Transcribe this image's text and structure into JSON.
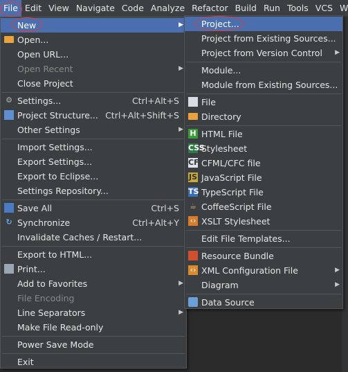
{
  "menubar": {
    "items": [
      {
        "label": "File",
        "name": "menubar-file",
        "active": true
      },
      {
        "label": "Edit",
        "name": "menubar-edit"
      },
      {
        "label": "View",
        "name": "menubar-view"
      },
      {
        "label": "Navigate",
        "name": "menubar-navigate"
      },
      {
        "label": "Code",
        "name": "menubar-code"
      },
      {
        "label": "Analyze",
        "name": "menubar-analyze"
      },
      {
        "label": "Refactor",
        "name": "menubar-refactor"
      },
      {
        "label": "Build",
        "name": "menubar-build"
      },
      {
        "label": "Run",
        "name": "menubar-run"
      },
      {
        "label": "Tools",
        "name": "menubar-tools"
      },
      {
        "label": "VCS",
        "name": "menubar-vcs"
      },
      {
        "label": "W",
        "name": "menubar-window"
      }
    ]
  },
  "file_menu": {
    "items": [
      {
        "type": "item",
        "label": "New",
        "name": "file-new",
        "selected": true,
        "arrow": true
      },
      {
        "type": "item",
        "label": "Open...",
        "name": "file-open",
        "icon": "folder",
        "icon_name": "folder-icon"
      },
      {
        "type": "item",
        "label": "Open URL...",
        "name": "file-open-url"
      },
      {
        "type": "item",
        "label": "Open Recent",
        "name": "file-open-recent",
        "disabled": true,
        "arrow": true
      },
      {
        "type": "item",
        "label": "Close Project",
        "name": "file-close-project"
      },
      {
        "type": "sep"
      },
      {
        "type": "item",
        "label": "Settings...",
        "name": "file-settings",
        "icon": "gear",
        "icon_name": "settings-icon",
        "shortcut": "Ctrl+Alt+S"
      },
      {
        "type": "item",
        "label": "Project Structure...",
        "name": "file-project-structure",
        "icon": "grid",
        "icon_name": "project-structure-icon",
        "shortcut": "Ctrl+Alt+Shift+S"
      },
      {
        "type": "item",
        "label": "Other Settings",
        "name": "file-other-settings",
        "arrow": true
      },
      {
        "type": "sep"
      },
      {
        "type": "item",
        "label": "Import Settings...",
        "name": "file-import-settings"
      },
      {
        "type": "item",
        "label": "Export Settings...",
        "name": "file-export-settings"
      },
      {
        "type": "item",
        "label": "Export to Eclipse...",
        "name": "file-export-eclipse"
      },
      {
        "type": "item",
        "label": "Settings Repository...",
        "name": "file-settings-repository"
      },
      {
        "type": "sep"
      },
      {
        "type": "item",
        "label": "Save All",
        "name": "file-save-all",
        "icon": "disk",
        "icon_name": "save-icon",
        "shortcut": "Ctrl+S"
      },
      {
        "type": "item",
        "label": "Synchronize",
        "name": "file-synchronize",
        "icon": "sync",
        "icon_name": "sync-icon",
        "shortcut": "Ctrl+Alt+Y"
      },
      {
        "type": "item",
        "label": "Invalidate Caches / Restart...",
        "name": "file-invalidate-caches"
      },
      {
        "type": "sep"
      },
      {
        "type": "item",
        "label": "Export to HTML...",
        "name": "file-export-html"
      },
      {
        "type": "item",
        "label": "Print...",
        "name": "file-print",
        "icon": "printer",
        "icon_name": "printer-icon"
      },
      {
        "type": "item",
        "label": "Add to Favorites",
        "name": "file-add-favorites",
        "arrow": true
      },
      {
        "type": "item",
        "label": "File Encoding",
        "name": "file-encoding",
        "disabled": true
      },
      {
        "type": "item",
        "label": "Line Separators",
        "name": "file-line-separators",
        "arrow": true
      },
      {
        "type": "item",
        "label": "Make File Read-only",
        "name": "file-make-read-only"
      },
      {
        "type": "sep"
      },
      {
        "type": "item",
        "label": "Power Save Mode",
        "name": "file-power-save"
      },
      {
        "type": "sep"
      },
      {
        "type": "item",
        "label": "Exit",
        "name": "file-exit"
      }
    ]
  },
  "new_menu": {
    "items": [
      {
        "type": "item",
        "label": "Project...",
        "name": "new-project",
        "selected": true
      },
      {
        "type": "item",
        "label": "Project from Existing Sources...",
        "name": "new-project-existing"
      },
      {
        "type": "item",
        "label": "Project from Version Control",
        "name": "new-project-vcs",
        "arrow": true
      },
      {
        "type": "sep"
      },
      {
        "type": "item",
        "label": "Module...",
        "name": "new-module"
      },
      {
        "type": "item",
        "label": "Module from Existing Sources...",
        "name": "new-module-existing"
      },
      {
        "type": "sep"
      },
      {
        "type": "item",
        "label": "File",
        "name": "new-file",
        "icon": "file-ic",
        "icon_name": "file-icon"
      },
      {
        "type": "item",
        "label": "Directory",
        "name": "new-directory",
        "icon": "folder",
        "icon_name": "folder-icon"
      },
      {
        "type": "sep"
      },
      {
        "type": "item",
        "label": "HTML File",
        "name": "new-html-file",
        "icon": "html-ic",
        "icon_name": "html-file-icon"
      },
      {
        "type": "item",
        "label": "Stylesheet",
        "name": "new-stylesheet",
        "icon": "css-ic",
        "icon_name": "css-file-icon"
      },
      {
        "type": "item",
        "label": "CFML/CFC file",
        "name": "new-cfml-file",
        "icon": "cf-ic",
        "icon_name": "cfml-file-icon"
      },
      {
        "type": "item",
        "label": "JavaScript File",
        "name": "new-javascript-file",
        "icon": "js-ic",
        "icon_name": "javascript-file-icon"
      },
      {
        "type": "item",
        "label": "TypeScript File",
        "name": "new-typescript-file",
        "icon": "ts-ic",
        "icon_name": "typescript-file-icon"
      },
      {
        "type": "item",
        "label": "CoffeeScript File",
        "name": "new-coffeescript-file",
        "icon": "coffee-ic",
        "icon_name": "coffeescript-file-icon"
      },
      {
        "type": "item",
        "label": "XSLT Stylesheet",
        "name": "new-xslt-stylesheet",
        "icon": "xsl-ic",
        "icon_name": "xslt-file-icon"
      },
      {
        "type": "sep"
      },
      {
        "type": "item",
        "label": "Edit File Templates...",
        "name": "new-edit-file-templates"
      },
      {
        "type": "sep"
      },
      {
        "type": "item",
        "label": "Resource Bundle",
        "name": "new-resource-bundle",
        "icon": "bundle-ic",
        "icon_name": "resource-bundle-icon"
      },
      {
        "type": "item",
        "label": "XML Configuration File",
        "name": "new-xml-config",
        "icon": "xml-ic",
        "icon_name": "xml-file-icon",
        "arrow": true
      },
      {
        "type": "item",
        "label": "Diagram",
        "name": "new-diagram",
        "arrow": true
      },
      {
        "type": "sep"
      },
      {
        "type": "item",
        "label": "Data Source",
        "name": "new-data-source",
        "icon": "db-ic",
        "icon_name": "data-source-icon"
      }
    ]
  }
}
